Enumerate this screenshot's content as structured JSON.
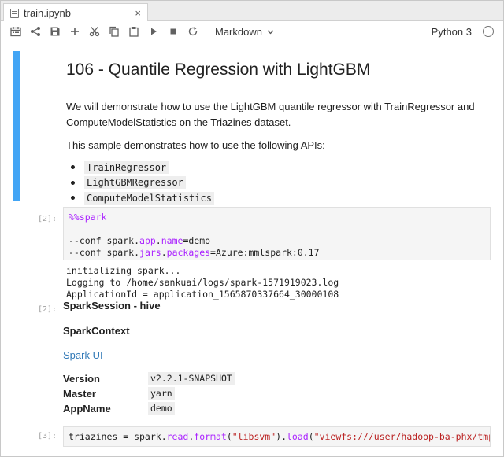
{
  "tab": {
    "title": "train.ipynb",
    "close": "×"
  },
  "toolbar": {
    "icons": [
      "calendar-icon",
      "share-icon",
      "save-icon",
      "plus-icon",
      "scissors-icon",
      "copy-icon",
      "paste-icon",
      "play-icon",
      "stop-icon",
      "refresh-icon"
    ],
    "cell_type": "Markdown",
    "kernel": "Python 3"
  },
  "markdown_cell": {
    "title": "106 - Quantile Regression with LightGBM",
    "paragraph1": "We will demonstrate how to use the LightGBM quantile regressor with TrainRegressor and ComputeModelStatistics on the Triazines dataset.",
    "paragraph2": "This sample demonstrates how to use the following APIs:",
    "apis": [
      "TrainRegressor",
      "LightGBMRegressor",
      "ComputeModelStatistics"
    ]
  },
  "cell2": {
    "prompt": "[2]:",
    "magic": "%%spark",
    "line1_prefix": "--conf spark.",
    "line1_kw": "app",
    "line1_mid": ".",
    "line1_kw2": "name",
    "line1_suffix": "=demo",
    "line2_prefix": "--conf spark.",
    "line2_kw": "jars",
    "line2_mid": ".",
    "line2_kw2": "packages",
    "line2_suffix": "=Azure:mmlspark:0.17"
  },
  "stdout": [
    "initializing spark...",
    "Logging to /home/sankuai/logs/spark-1571919023.log",
    "ApplicationId = application_1565870337664_30000108"
  ],
  "output2": {
    "prompt": "[2]:",
    "session": "SparkSession - hive",
    "context": "SparkContext",
    "spark_ui": "Spark UI",
    "rows": [
      {
        "key": "Version",
        "value": "v2.2.1-SNAPSHOT"
      },
      {
        "key": "Master",
        "value": "yarn"
      },
      {
        "key": "AppName",
        "value": "demo"
      }
    ]
  },
  "cell3": {
    "prompt": "[3]:",
    "code_a": "triazines = spark.",
    "code_b": "read",
    "code_c": ".",
    "code_d": "format",
    "code_e": "(",
    "code_f": "\"libsvm\"",
    "code_g": ").",
    "code_h": "load",
    "code_i": "(",
    "code_j": "\"viewfs:///user/hadoop-ba-phx/tmp/tr"
  }
}
